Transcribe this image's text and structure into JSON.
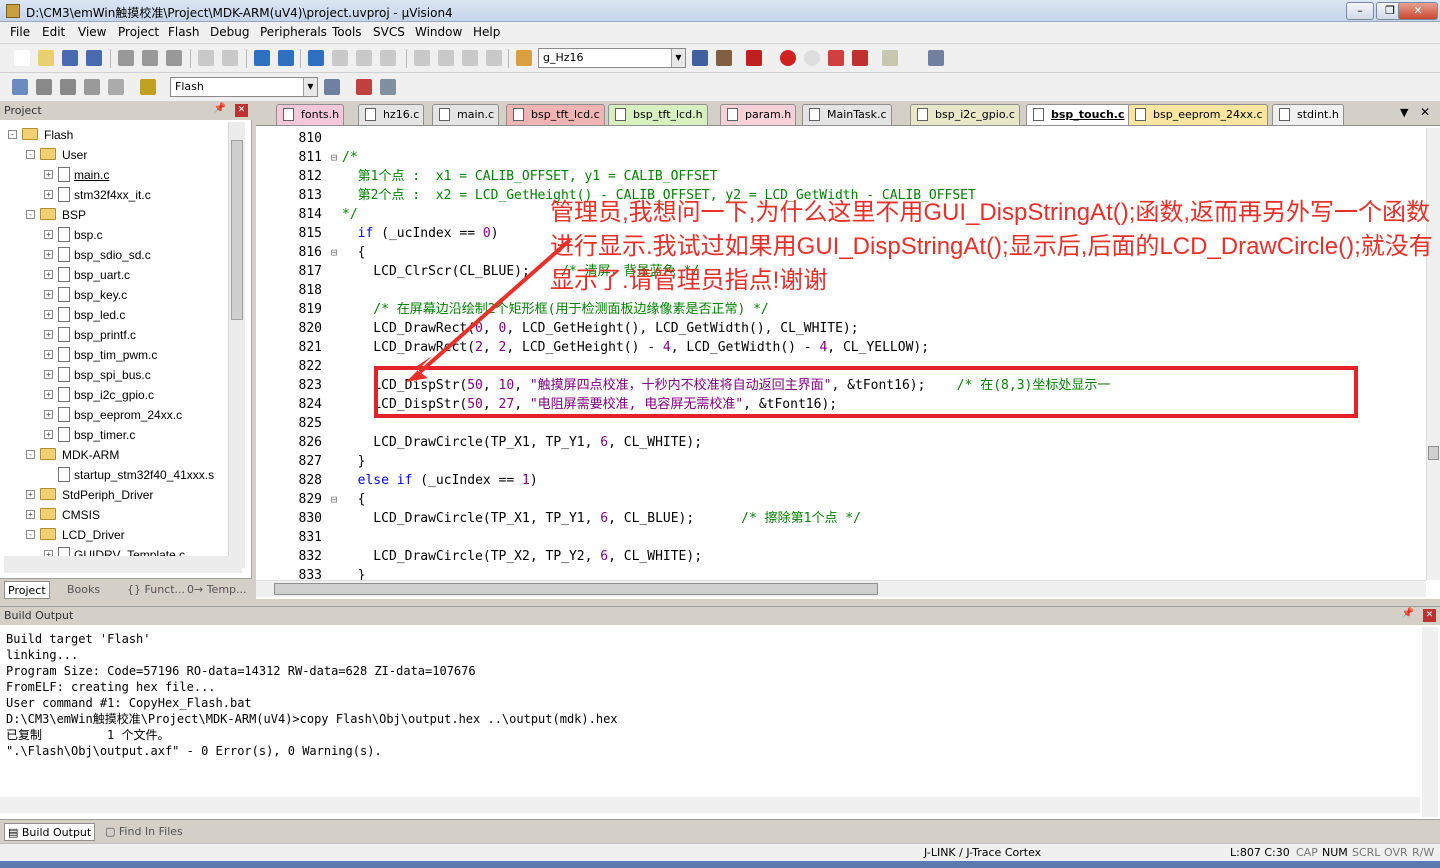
{
  "window": {
    "title": "D:\\CM3\\emWin触摸校准\\Project\\MDK-ARM(uV4)\\project.uvproj - µVision4"
  },
  "menu": [
    "File",
    "Edit",
    "View",
    "Project",
    "Flash",
    "Debug",
    "Peripherals",
    "Tools",
    "SVCS",
    "Window",
    "Help"
  ],
  "toolbar": {
    "find_combo": "g_Hz16",
    "target_combo": "Flash"
  },
  "project": {
    "title": "Project",
    "tree": [
      {
        "label": "Flash",
        "level": 0,
        "type": "folder",
        "exp": "-"
      },
      {
        "label": "User",
        "level": 1,
        "type": "folder",
        "exp": "-"
      },
      {
        "label": "main.c",
        "level": 2,
        "type": "file",
        "exp": "+"
      },
      {
        "label": "stm32f4xx_it.c",
        "level": 2,
        "type": "file",
        "exp": "+"
      },
      {
        "label": "BSP",
        "level": 1,
        "type": "folder",
        "exp": "-"
      },
      {
        "label": "bsp.c",
        "level": 2,
        "type": "file",
        "exp": "+"
      },
      {
        "label": "bsp_sdio_sd.c",
        "level": 2,
        "type": "file",
        "exp": "+"
      },
      {
        "label": "bsp_uart.c",
        "level": 2,
        "type": "file",
        "exp": "+"
      },
      {
        "label": "bsp_key.c",
        "level": 2,
        "type": "file",
        "exp": "+"
      },
      {
        "label": "bsp_led.c",
        "level": 2,
        "type": "file",
        "exp": "+"
      },
      {
        "label": "bsp_printf.c",
        "level": 2,
        "type": "file",
        "exp": "+"
      },
      {
        "label": "bsp_tim_pwm.c",
        "level": 2,
        "type": "file",
        "exp": "+"
      },
      {
        "label": "bsp_spi_bus.c",
        "level": 2,
        "type": "file",
        "exp": "+"
      },
      {
        "label": "bsp_i2c_gpio.c",
        "level": 2,
        "type": "file",
        "exp": "+"
      },
      {
        "label": "bsp_eeprom_24xx.c",
        "level": 2,
        "type": "file",
        "exp": "+"
      },
      {
        "label": "bsp_timer.c",
        "level": 2,
        "type": "file",
        "exp": "+"
      },
      {
        "label": "MDK-ARM",
        "level": 1,
        "type": "folder",
        "exp": "-"
      },
      {
        "label": "startup_stm32f40_41xxx.s",
        "level": 2,
        "type": "file",
        "exp": ""
      },
      {
        "label": "StdPeriph_Driver",
        "level": 1,
        "type": "folder",
        "exp": "+"
      },
      {
        "label": "CMSIS",
        "level": 1,
        "type": "folder",
        "exp": "+"
      },
      {
        "label": "LCD_Driver",
        "level": 1,
        "type": "folder",
        "exp": "-"
      },
      {
        "label": "GUIDRV_Template.c",
        "level": 2,
        "type": "file",
        "exp": "+"
      }
    ],
    "tabs": [
      "Project",
      "Books",
      "{} Funct...",
      "0→ Temp..."
    ]
  },
  "editor_tabs": [
    {
      "label": "fonts.h",
      "color": "#f4c8d8"
    },
    {
      "label": "hz16.c",
      "color": "#e4e4e4"
    },
    {
      "label": "main.c",
      "color": "#e4e4e4"
    },
    {
      "label": "bsp_tft_lcd.c",
      "color": "#f0b4b4"
    },
    {
      "label": "bsp_tft_lcd.h",
      "color": "#d8f0c0"
    },
    {
      "label": "param.h",
      "color": "#f8d0d8"
    },
    {
      "label": "MainTask.c",
      "color": "#e4e4e4"
    },
    {
      "label": "bsp_i2c_gpio.c",
      "color": "#e8e8c8"
    },
    {
      "label": "bsp_touch.c",
      "color": "#ffffff",
      "active": true
    },
    {
      "label": "bsp_eeprom_24xx.c",
      "color": "#fae6a0"
    },
    {
      "label": "stdint.h",
      "color": "#f0f0f0"
    }
  ],
  "code": [
    {
      "n": "810",
      "g": "",
      "parts": []
    },
    {
      "n": "811",
      "g": "⊟",
      "parts": [
        [
          "cm",
          "/*"
        ]
      ]
    },
    {
      "n": "812",
      "g": "",
      "parts": [
        [
          "cm",
          "  第1个点 :  x1 = CALIB_OFFSET, y1 = CALIB_OFFSET"
        ]
      ]
    },
    {
      "n": "813",
      "g": "",
      "parts": [
        [
          "cm",
          "  第2个点 :  x2 = LCD_GetHeight() - CALIB_OFFSET, y2 = LCD_GetWidth - CALIB_OFFSET"
        ]
      ]
    },
    {
      "n": "814",
      "g": "",
      "parts": [
        [
          "cm",
          "*/"
        ]
      ]
    },
    {
      "n": "815",
      "g": "",
      "parts": [
        [
          "pl",
          "  "
        ],
        [
          "kw",
          "if"
        ],
        [
          "pl",
          " (_ucIndex == "
        ],
        [
          "num",
          "0"
        ],
        [
          "pl",
          ")"
        ]
      ]
    },
    {
      "n": "816",
      "g": "⊟",
      "parts": [
        [
          "pl",
          "  {"
        ]
      ]
    },
    {
      "n": "817",
      "g": "",
      "parts": [
        [
          "pl",
          "    LCD_ClrScr(CL_BLUE);    "
        ],
        [
          "cm",
          "/* 清屏，背景蓝色 */"
        ]
      ]
    },
    {
      "n": "818",
      "g": "",
      "parts": []
    },
    {
      "n": "819",
      "g": "",
      "parts": [
        [
          "cm",
          "    /* 在屏幕边沿绘制2个矩形框(用于检测面板边缘像素是否正常) */"
        ]
      ]
    },
    {
      "n": "820",
      "g": "",
      "parts": [
        [
          "pl",
          "    LCD_DrawRect("
        ],
        [
          "num",
          "0"
        ],
        [
          "pl",
          ", "
        ],
        [
          "num",
          "0"
        ],
        [
          "pl",
          ", LCD_GetHeight(), LCD_GetWidth(), CL_WHITE);"
        ]
      ]
    },
    {
      "n": "821",
      "g": "",
      "parts": [
        [
          "pl",
          "    LCD_DrawRect("
        ],
        [
          "num",
          "2"
        ],
        [
          "pl",
          ", "
        ],
        [
          "num",
          "2"
        ],
        [
          "pl",
          ", LCD_GetHeight() - "
        ],
        [
          "num",
          "4"
        ],
        [
          "pl",
          ", LCD_GetWidth() - "
        ],
        [
          "num",
          "4"
        ],
        [
          "pl",
          ", CL_YELLOW);"
        ]
      ]
    },
    {
      "n": "822",
      "g": "",
      "parts": []
    },
    {
      "n": "823",
      "g": "",
      "parts": [
        [
          "pl",
          "    LCD_DispStr("
        ],
        [
          "num",
          "50"
        ],
        [
          "pl",
          ", "
        ],
        [
          "num",
          "10"
        ],
        [
          "pl",
          ", "
        ],
        [
          "str",
          "\"触摸屏四点校准，十秒内不校准将自动返回主界面\""
        ],
        [
          "pl",
          ", &tFont16);    "
        ],
        [
          "cm",
          "/* 在(8,3)坐标处显示一"
        ]
      ]
    },
    {
      "n": "824",
      "g": "",
      "parts": [
        [
          "pl",
          "    LCD_DispStr("
        ],
        [
          "num",
          "50"
        ],
        [
          "pl",
          ", "
        ],
        [
          "num",
          "27"
        ],
        [
          "pl",
          ", "
        ],
        [
          "str",
          "\"电阻屏需要校准, 电容屏无需校准\""
        ],
        [
          "pl",
          ", &tFont16);"
        ]
      ]
    },
    {
      "n": "825",
      "g": "",
      "parts": []
    },
    {
      "n": "826",
      "g": "",
      "parts": [
        [
          "pl",
          "    LCD_DrawCircle(TP_X1, TP_Y1, "
        ],
        [
          "num",
          "6"
        ],
        [
          "pl",
          ", CL_WHITE);"
        ]
      ]
    },
    {
      "n": "827",
      "g": "",
      "parts": [
        [
          "pl",
          "  }"
        ]
      ]
    },
    {
      "n": "828",
      "g": "",
      "parts": [
        [
          "pl",
          "  "
        ],
        [
          "kw",
          "else if"
        ],
        [
          "pl",
          " (_ucIndex == "
        ],
        [
          "num",
          "1"
        ],
        [
          "pl",
          ")"
        ]
      ]
    },
    {
      "n": "829",
      "g": "⊟",
      "parts": [
        [
          "pl",
          "  {"
        ]
      ]
    },
    {
      "n": "830",
      "g": "",
      "parts": [
        [
          "pl",
          "    LCD_DrawCircle(TP_X1, TP_Y1, "
        ],
        [
          "num",
          "6"
        ],
        [
          "pl",
          ", CL_BLUE);      "
        ],
        [
          "cm",
          "/* 擦除第1个点 */"
        ]
      ]
    },
    {
      "n": "831",
      "g": "",
      "parts": []
    },
    {
      "n": "832",
      "g": "",
      "parts": [
        [
          "pl",
          "    LCD_DrawCircle(TP_X2, TP_Y2, "
        ],
        [
          "num",
          "6"
        ],
        [
          "pl",
          ", CL_WHITE);"
        ]
      ]
    },
    {
      "n": "833",
      "g": "",
      "parts": [
        [
          "pl",
          "  }"
        ]
      ]
    }
  ],
  "annotation": "管理员,我想问一下,为什么这里不用GUI_DispStringAt();函数,返而再另外写一个函数进行显示.我试过如果用GUI_DispStringAt();显示后,后面的LCD_DrawCircle();就没有显示了.请管理员指点!谢谢",
  "build": {
    "title": "Build Output",
    "lines": [
      "Build target 'Flash'",
      "linking...",
      "Program Size: Code=57196 RO-data=14312 RW-data=628 ZI-data=107676",
      "FromELF: creating hex file...",
      "User command #1: CopyHex_Flash.bat",
      "D:\\CM3\\emWin触摸校准\\Project\\MDK-ARM(uV4)>copy Flash\\Obj\\output.hex ..\\output(mdk).hex",
      "已复制         1 个文件。",
      "\".\\Flash\\Obj\\output.axf\" - 0 Error(s), 0 Warning(s)."
    ],
    "tabs": [
      "Build Output",
      "Find In Files"
    ]
  },
  "status": {
    "debugger": "J-LINK / J-Trace Cortex",
    "pos": "L:807 C:30",
    "caps": "CAP",
    "num": "NUM",
    "scrl": "SCRL",
    "ovr": "OVR",
    "rw": "R/W"
  }
}
